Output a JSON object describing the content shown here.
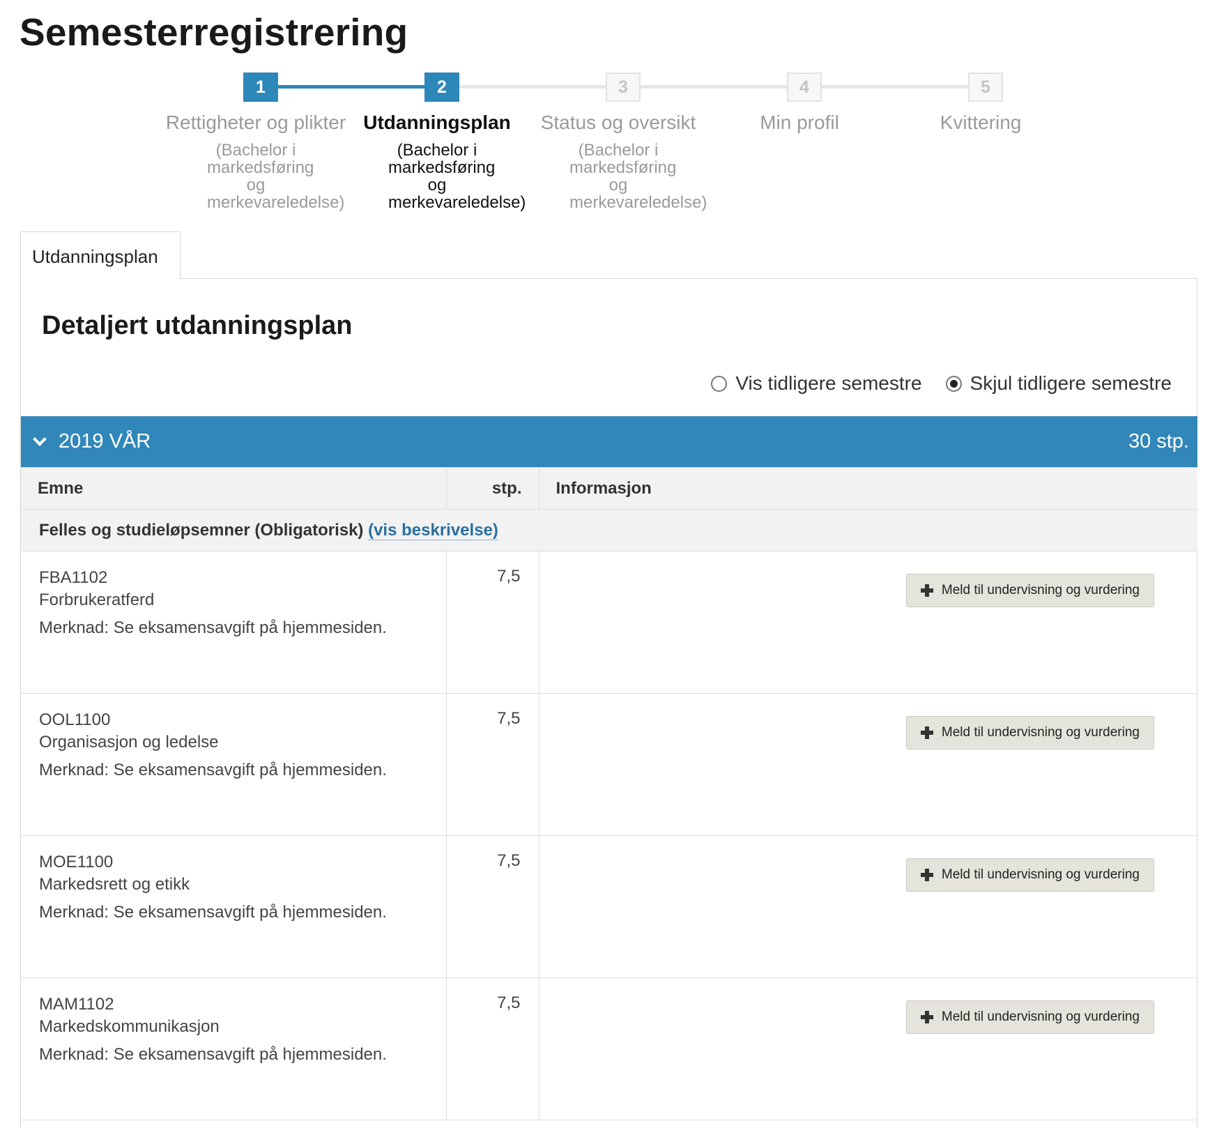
{
  "page": {
    "title": "Semesterregistrering"
  },
  "stepper": {
    "steps": [
      {
        "number": "1",
        "label": "Rettigheter og plikter",
        "sub": "(Bachelor i markedsføring og merkevareledelse)"
      },
      {
        "number": "2",
        "label": "Utdanningsplan",
        "sub": "(Bachelor i markedsføring og merkevareledelse)"
      },
      {
        "number": "3",
        "label": "Status og oversikt",
        "sub": "(Bachelor i markedsføring og merkevareledelse)"
      },
      {
        "number": "4",
        "label": "Min profil",
        "sub": ""
      },
      {
        "number": "5",
        "label": "Kvittering",
        "sub": ""
      }
    ],
    "current_step": 2
  },
  "tabs": [
    {
      "label": "Utdanningsplan"
    }
  ],
  "plan": {
    "title": "Detaljert utdanningsplan",
    "options": {
      "show_previous": "Vis tidligere semestre",
      "hide_previous": "Skjul tidligere semestre",
      "selected": "hide_previous"
    },
    "semester": {
      "label": "2019 VÅR",
      "credits": "30 stp."
    },
    "columns": {
      "course": "Emne",
      "credits": "stp.",
      "info": "Informasjon"
    },
    "group": {
      "label": "Felles og studieløpsemner (Obligatorisk)",
      "link": "(vis beskrivelse)"
    },
    "courses": [
      {
        "code": "FBA1102",
        "name": "Forbrukeratferd",
        "note": "Merknad: Se eksamensavgift på hjemmesiden.",
        "credits": "7,5",
        "action": "Meld til undervisning og vurdering"
      },
      {
        "code": "OOL1100",
        "name": "Organisasjon og ledelse",
        "note": "Merknad: Se eksamensavgift på hjemmesiden.",
        "credits": "7,5",
        "action": "Meld til undervisning og vurdering"
      },
      {
        "code": "MOE1100",
        "name": "Markedsrett og etikk",
        "note": "Merknad: Se eksamensavgift på hjemmesiden.",
        "credits": "7,5",
        "action": "Meld til undervisning og vurdering"
      },
      {
        "code": "MAM1102",
        "name": "Markedskommunikasjon",
        "note": "Merknad: Se eksamensavgift på hjemmesiden.",
        "credits": "7,5",
        "action": "Meld til undervisning og vurdering"
      }
    ]
  },
  "colors": {
    "accent": "#3187b9",
    "button_bg": "#e4e4dc",
    "header_bg": "#f2f2f2"
  }
}
